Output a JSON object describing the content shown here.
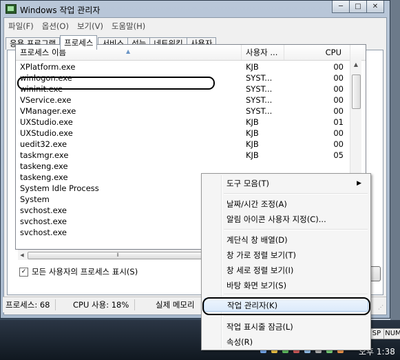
{
  "window": {
    "title": "Windows 작업 관리자",
    "buttons": [
      "─",
      "□",
      "✕"
    ]
  },
  "menubar": [
    "파일(F)",
    "옵션(O)",
    "보기(V)",
    "도움말(H)"
  ],
  "tabs": [
    "응용 프로그램",
    "프로세스",
    "서비스",
    "성능",
    "네트워킹",
    "사용자"
  ],
  "active_tab": "프로세스",
  "columns": {
    "name": "프로세스 이름",
    "user": "사용자 ...",
    "cpu": "CPU"
  },
  "processes": [
    {
      "name": "XPlatform.exe",
      "user": "KJB",
      "cpu": "00"
    },
    {
      "name": "winlogon.exe",
      "user": "SYST...",
      "cpu": "00"
    },
    {
      "name": "wininit.exe",
      "user": "SYST...",
      "cpu": "00"
    },
    {
      "name": "VService.exe",
      "user": "SYST...",
      "cpu": "00"
    },
    {
      "name": "VManager.exe",
      "user": "SYST...",
      "cpu": "00"
    },
    {
      "name": "UXStudio.exe",
      "user": "KJB",
      "cpu": "01"
    },
    {
      "name": "UXStudio.exe",
      "user": "KJB",
      "cpu": "00"
    },
    {
      "name": "uedit32.exe",
      "user": "KJB",
      "cpu": "00"
    },
    {
      "name": "taskmgr.exe",
      "user": "KJB",
      "cpu": "05"
    },
    {
      "name": "taskeng.exe",
      "user": "",
      "cpu": ""
    },
    {
      "name": "taskeng.exe",
      "user": "",
      "cpu": ""
    },
    {
      "name": "System Idle Process",
      "user": "",
      "cpu": ""
    },
    {
      "name": "System",
      "user": "",
      "cpu": ""
    },
    {
      "name": "svchost.exe",
      "user": "",
      "cpu": ""
    },
    {
      "name": "svchost.exe",
      "user": "",
      "cpu": ""
    },
    {
      "name": "svchost.exe",
      "user": "",
      "cpu": ""
    }
  ],
  "show_all_users": {
    "label": "모든 사용자의 프로세스 표시(S)",
    "checked": true,
    "mark": "✓"
  },
  "hscroll_grip": "⦀",
  "statusbar": {
    "processes": "프로세스: 68",
    "cpu": "CPU 사용: 18%",
    "memory": "실제 메모리"
  },
  "context_menu": {
    "items": [
      {
        "label": "도구 모음(T)",
        "has_submenu": true
      },
      {
        "label": "날짜/시간 조정(A)"
      },
      {
        "label": "알림 아이콘 사용자 지정(C)..."
      },
      {
        "label": "계단식 창 배열(D)"
      },
      {
        "label": "창 가로 정렬 보기(T)"
      },
      {
        "label": "창 세로 정렬 보기(I)"
      },
      {
        "label": "바탕 화면 보기(S)"
      },
      {
        "label": "작업 관리자(K)",
        "highlighted": true
      },
      {
        "label": "작업 표시줄 잠금(L)"
      },
      {
        "label": "속성(R)"
      }
    ],
    "submenu_arrow": "▶"
  },
  "tray": {
    "caps": "SP",
    "num": "NUM",
    "clock": "오후 1:38"
  },
  "colors": {
    "highlight": "#dceafb",
    "taskbar": "#1a2330",
    "title_bg": "#b9c7d8"
  }
}
